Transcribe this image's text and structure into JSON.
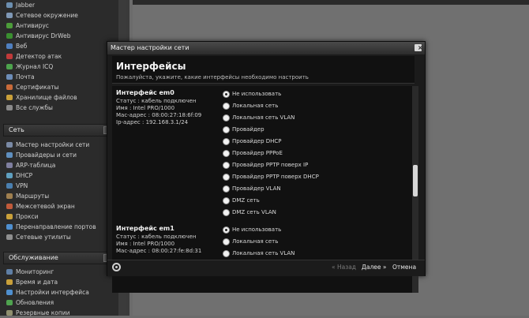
{
  "sidebar": {
    "top_items": [
      {
        "label": "Jabber",
        "color": "#6c8fb0"
      },
      {
        "label": "Сетевое окружение",
        "color": "#7f98b5"
      },
      {
        "label": "Антивирус",
        "color": "#4c9c3a"
      },
      {
        "label": "Антивирус DrWeb",
        "color": "#3a8f30"
      },
      {
        "label": "Веб",
        "color": "#4f7fbf"
      },
      {
        "label": "Детектор атак",
        "color": "#c03a3a"
      },
      {
        "label": "Журнал ICQ",
        "color": "#4da34d"
      },
      {
        "label": "Почта",
        "color": "#6d8db8"
      },
      {
        "label": "Сертификаты",
        "color": "#c96b3a"
      },
      {
        "label": "Хранилище файлов",
        "color": "#c9a03a"
      },
      {
        "label": "Все службы",
        "color": "#8a8a8a"
      }
    ],
    "section_net": "Сеть",
    "net_items": [
      {
        "label": "Мастер настройки сети",
        "color": "#7a8aa5"
      },
      {
        "label": "Провайдеры и сети",
        "color": "#5f8fbf"
      },
      {
        "label": "ARP-таблица",
        "color": "#7f7f9f"
      },
      {
        "label": "DHCP",
        "color": "#5f9fbf"
      },
      {
        "label": "VPN",
        "color": "#4a7faf"
      },
      {
        "label": "Маршруты",
        "color": "#9f7f4f"
      },
      {
        "label": "Межсетевой экран",
        "color": "#c05a3a"
      },
      {
        "label": "Прокси",
        "color": "#c9a03a"
      },
      {
        "label": "Перенаправление портов",
        "color": "#4f8fcf"
      },
      {
        "label": "Сетевые утилиты",
        "color": "#8f8f8f"
      }
    ],
    "section_service": "Обслуживание",
    "service_items": [
      {
        "label": "Мониторинг",
        "color": "#5f7fa5"
      },
      {
        "label": "Время и дата",
        "color": "#c9a03a"
      },
      {
        "label": "Настройки интерфейса",
        "color": "#4f8fcf"
      },
      {
        "label": "Обновления",
        "color": "#4fa34f"
      },
      {
        "label": "Резервные копии",
        "color": "#8f8f6f"
      }
    ]
  },
  "modal": {
    "title": "Мастер настройки сети",
    "close": "×",
    "heading": "Интерфейсы",
    "subheading": "Пожалуйста, укажите, какие интерфейсы необходимо настроить",
    "interfaces": [
      {
        "title": "Интерфейс em0",
        "status": "Статус : кабель подключен",
        "name": "Имя : Intel PRO/1000",
        "mac": "Mac-адрес : 08:00:27:18:6f:09",
        "ip": "Ip-адрес : 192.168.3.1/24",
        "options": [
          "Не использовать",
          "Локальная сеть",
          "Локальная сеть VLAN",
          "Провайдер",
          "Провайдер DHCP",
          "Провайдер PPPoE",
          "Провайдер PPTP поверх IP",
          "Провайдер PPTP поверх DHCP",
          "Провайдер VLAN",
          "DMZ сеть",
          "DMZ сеть VLAN"
        ],
        "selected": 0
      },
      {
        "title": "Интерфейс em1",
        "status": "Статус : кабель подключен",
        "name": "Имя : Intel PRO/1000",
        "mac": "Mac-адрес : 08:00:27:fe:8d:31",
        "options": [
          "Не использовать",
          "Локальная сеть",
          "Локальная сеть VLAN"
        ],
        "selected": 0
      }
    ],
    "footer": {
      "back": "« Назад",
      "next": "Далее »",
      "cancel": "Отмена"
    }
  }
}
